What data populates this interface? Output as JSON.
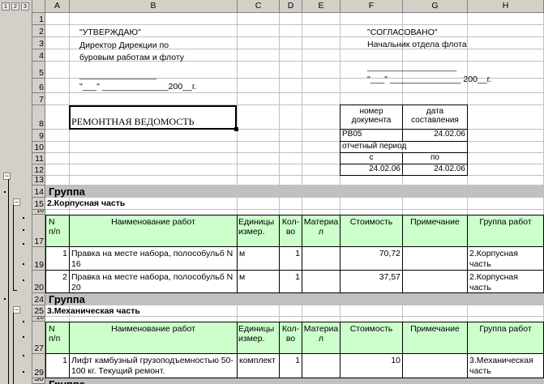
{
  "outline": {
    "levels": [
      "1",
      "2",
      "3"
    ]
  },
  "columns": [
    "A",
    "B",
    "C",
    "D",
    "E",
    "F",
    "G",
    "H"
  ],
  "rows": [
    "1",
    "2",
    "3",
    "4",
    "5",
    "6",
    "7",
    "8",
    "9",
    "10",
    "11",
    "12",
    "13",
    "14",
    "15",
    "16",
    "17",
    "19",
    "20",
    "24",
    "25",
    "26",
    "27",
    "29",
    "30"
  ],
  "header_left": {
    "approve": "\"УТВЕРЖДАЮ\"",
    "position1": "Директор Дирекции по",
    "position2": "буровым работам и флоту",
    "sign_line": "___________________",
    "date_line": "\"___\" ______________200__г."
  },
  "header_right": {
    "agreed": "\"СОГЛАСОВАНО\"",
    "position": "Начальник отдела флота",
    "sign_line": "______________________",
    "date_line": "\"___\" _______________ 200__г."
  },
  "title": "РЕМОНТНАЯ ВЕДОМОСТЬ",
  "docbox": {
    "num_label1": "номер",
    "num_label2": "документа",
    "date_label1": "дата",
    "date_label2": "составления",
    "num_value": "РВ05",
    "date_value": "24.02.06",
    "period_label": "отчетный период",
    "from_label": "с",
    "to_label": "по",
    "from_value": "24.02.06",
    "to_value": "24.02.06"
  },
  "group_band": "Группа",
  "section1": "2.Корпусная часть",
  "section2": "3.Механическая часть",
  "table_headers": {
    "num1": "N",
    "num2": "п/п",
    "name": "Наименование работ",
    "unit1": "Единицы",
    "unit2": "измер.",
    "qty1": "Кол-",
    "qty2": "во",
    "mat1": "Материа",
    "mat2": "л",
    "cost": "Стоимость",
    "note": "Примечание",
    "group": "Группа работ"
  },
  "items1": [
    {
      "n": "1",
      "name1": "Правка на месте набора, полособульб N",
      "name2": "16",
      "unit": "м",
      "qty": "1",
      "cost": "70,72",
      "group1": "2.Корпусная",
      "group2": "часть"
    },
    {
      "n": "2",
      "name1": "Правка на месте набора, полособульб N",
      "name2": "20",
      "unit": "м",
      "qty": "1",
      "cost": "37,57",
      "group1": "2.Корпусная",
      "group2": "часть"
    }
  ],
  "items2": [
    {
      "n": "1",
      "name1": "Лифт камбузный грузоподъемностью 50-",
      "name2": "100 кг. Текущий ремонт.",
      "unit": "комплект",
      "qty": "1",
      "cost": "10",
      "group1": "3.Механическая",
      "group2": "часть"
    }
  ]
}
